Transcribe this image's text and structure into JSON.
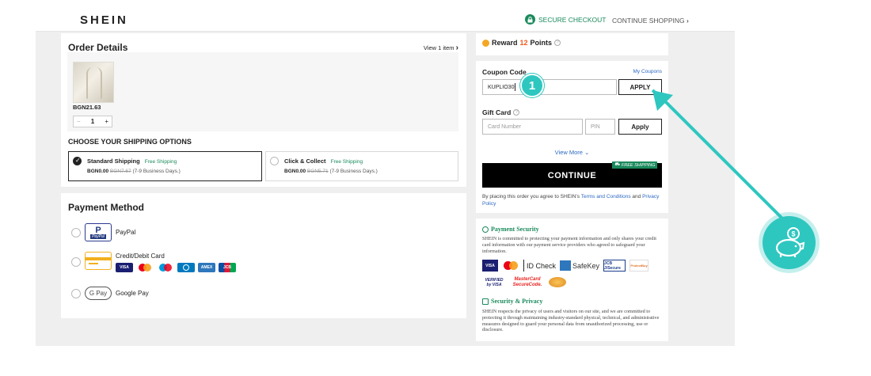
{
  "header": {
    "logo": "SHEIN",
    "secure_checkout": "SECURE CHECKOUT",
    "continue_shopping": "CONTINUE SHOPPING"
  },
  "order": {
    "title": "Order Details",
    "view_items": "View 1 item",
    "item_price": "BGN21.63",
    "quantity": "1",
    "minus": "−",
    "plus": "+"
  },
  "shipping": {
    "title": "CHOOSE YOUR SHIPPING OPTIONS",
    "options": [
      {
        "name": "Standard Shipping",
        "tag": "Free Shipping",
        "price": "BGN0.00",
        "old_price": "BGN7.67",
        "eta": "(7-9 Business Days.)",
        "selected": true
      },
      {
        "name": "Click & Collect",
        "tag": "Free Shipping",
        "price": "BGN0.00",
        "old_price": "BGN5.71",
        "eta": "(7-9 Business Days.)",
        "selected": false
      }
    ]
  },
  "payment": {
    "title": "Payment Method",
    "methods": [
      {
        "label": "PayPal",
        "icon": "paypal-icon"
      },
      {
        "label": "Credit/Debit Card",
        "icon": "credit-card-icon"
      },
      {
        "label": "Google Pay",
        "icon": "google-pay-icon"
      }
    ],
    "paypal_logo": "PayPal",
    "gpay_logo": "G Pay",
    "cards": [
      "VISA",
      "",
      "",
      "",
      "AMEX",
      "JCB"
    ]
  },
  "reward": {
    "prefix": "Reward",
    "points": "12",
    "suffix": "Points"
  },
  "coupon": {
    "title": "Coupon Code",
    "my_coupons": "My Coupons",
    "value": "KUPLIO30",
    "apply": "APPLY",
    "gift_title": "Gift Card",
    "card_placeholder": "Card Number",
    "pin_placeholder": "PIN",
    "gift_apply": "Apply",
    "view_more": "View More",
    "continue": "CONTINUE",
    "free_shipping_tag": "FREE SHIPPING",
    "terms_prefix": "By placing this order you agree to SHEIN's",
    "terms_link": "Terms and Conditions",
    "terms_and": "and",
    "privacy_link": "Privacy Policy"
  },
  "security": {
    "title": "Payment Security",
    "text": "SHEIN is committed to protecting your payment information and only shares your credit card information with our payment service providers who agreed to safeguard your information.",
    "logos": [
      "VISA",
      "",
      "ID Check",
      "SafeKey",
      "JCB J/Secure",
      "ProtectBuy",
      "VERIFIED by VISA",
      "MasterCard SecureCode.",
      ""
    ],
    "privacy_title": "Security & Privacy",
    "privacy_text": "SHEIN respects the privacy of users and visitors on our site, and we are committed to protecting it through maintaining industry-standard physical, technical, and administrative measures designed to guard your personal data from unauthorized processing, use or disclosure."
  },
  "overlay": {
    "step_number": "1"
  },
  "colors": {
    "brand_green": "#1a8a5c",
    "reward_orange": "#f05a23",
    "teal_overlay": "#2ec7c0",
    "link_blue": "#2d68c4"
  }
}
